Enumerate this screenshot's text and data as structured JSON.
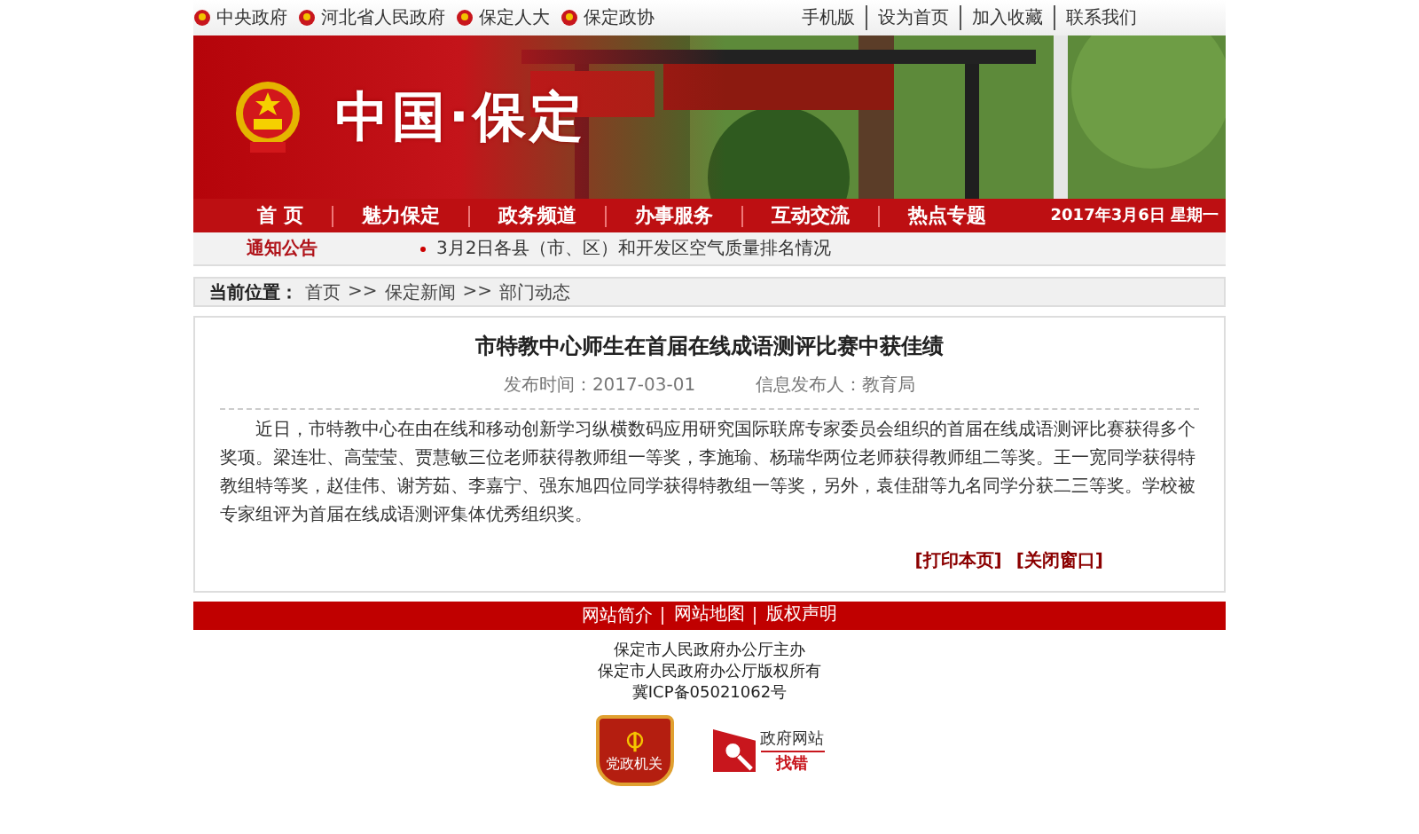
{
  "top_links": [
    {
      "label": "中央政府"
    },
    {
      "label": "河北省人民政府"
    },
    {
      "label": "保定人大"
    },
    {
      "label": "保定政协"
    }
  ],
  "top_right": [
    "手机版",
    "设为首页",
    "加入收藏",
    "联系我们"
  ],
  "banner": {
    "title": "中国·保定"
  },
  "nav": {
    "items": [
      {
        "label": "首 页"
      },
      {
        "label": "魅力保定"
      },
      {
        "label": "政务频道"
      },
      {
        "label": "办事服务"
      },
      {
        "label": "互动交流"
      },
      {
        "label": "热点专题"
      }
    ],
    "date": "2017年3月6日  星期一"
  },
  "notice": {
    "label": "通知公告",
    "items": [
      "3月2日各县（市、区）和开发区空气质量排名情况"
    ]
  },
  "breadcrumb": {
    "label": "当前位置：",
    "items": [
      "首页",
      "保定新闻",
      "部门动态"
    ],
    "separator": ">>"
  },
  "article": {
    "title": "市特教中心师生在首届在线成语测评比赛中获佳绩",
    "published": "发布时间：2017-03-01",
    "publisher": "信息发布人：教育局",
    "body": "近日，市特教中心在由在线和移动创新学习纵横数码应用研究国际联席专家委员会组织的首届在线成语测评比赛获得多个奖项。梁连壮、高莹莹、贾慧敏三位老师获得教师组一等奖，李施瑜、杨瑞华两位老师获得教师组二等奖。王一宽同学获得特教组特等奖，赵佳伟、谢芳茹、李嘉宁、强东旭四位同学获得特教组一等奖，另外，袁佳甜等九名同学分获二三等奖。学校被专家组评为首届在线成语测评集体优秀组织奖。",
    "actions": [
      "[打印本页]",
      "[关闭窗口]"
    ]
  },
  "footer": {
    "links": [
      "网站简介",
      "网站地图",
      "版权声明"
    ],
    "lines": [
      "保定市人民政府办公厅主办",
      "保定市人民政府办公厅版权所有",
      "冀ICP备05021062号"
    ],
    "badge": "党政机关",
    "error_report": {
      "top": "政府网站",
      "bottom": "找错"
    }
  }
}
